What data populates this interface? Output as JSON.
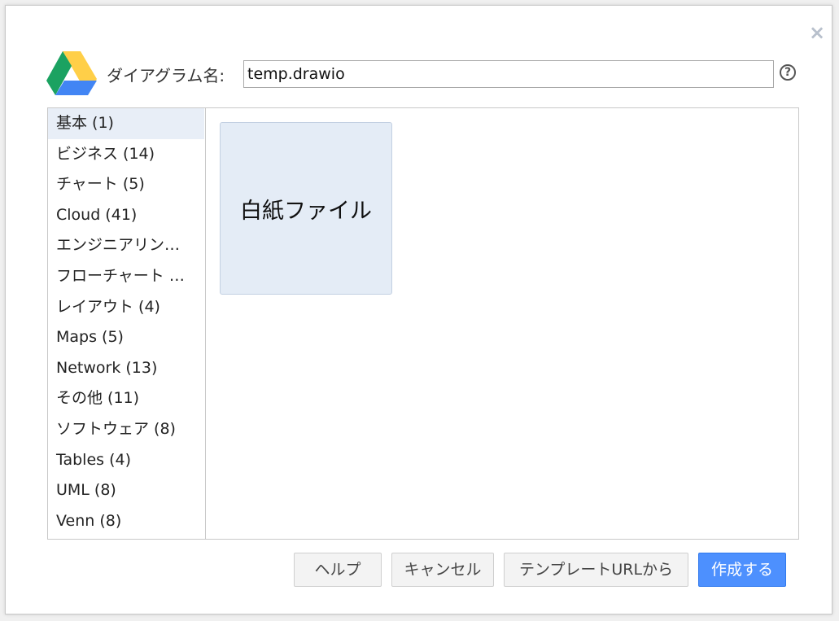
{
  "dialog": {
    "close_glyph": "×",
    "name_label": "ダイアグラム名:",
    "name_value": "temp.drawio",
    "help_glyph": "?"
  },
  "categories": [
    {
      "label": "基本 (1)",
      "selected": true
    },
    {
      "label": "ビジネス (14)"
    },
    {
      "label": "チャート (5)"
    },
    {
      "label": "Cloud (41)"
    },
    {
      "label": "エンジニアリン…"
    },
    {
      "label": "フローチャート …"
    },
    {
      "label": "レイアウト (4)"
    },
    {
      "label": "Maps (5)"
    },
    {
      "label": "Network (13)"
    },
    {
      "label": "その他 (11)"
    },
    {
      "label": "ソフトウェア (8)"
    },
    {
      "label": "Tables (4)"
    },
    {
      "label": "UML (8)"
    },
    {
      "label": "Venn (8)"
    }
  ],
  "templates": [
    {
      "label": "白紙ファイル"
    }
  ],
  "buttons": {
    "help": "ヘルプ",
    "cancel": "キャンセル",
    "from_url": "テンプレートURLから",
    "create": "作成する"
  },
  "colors": {
    "primary": "#4d90fe",
    "selected_bg": "#e8eef7",
    "template_bg": "#e4ecf6"
  },
  "icons": {
    "logo": "google-drive-icon",
    "help": "help-circle-icon",
    "close": "close-icon"
  }
}
